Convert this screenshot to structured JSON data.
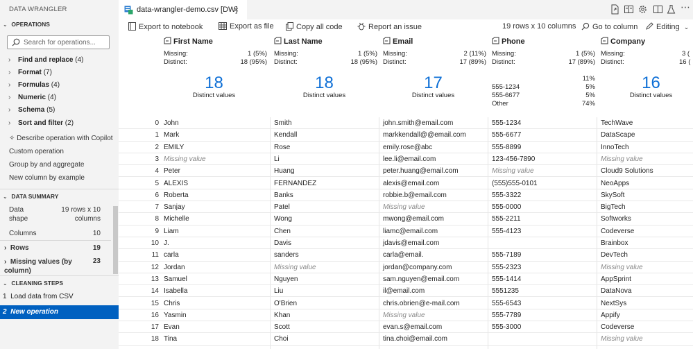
{
  "sidebar": {
    "title": "DATA WRANGLER",
    "operations_header": "OPERATIONS",
    "search_placeholder": "Search for operations...",
    "operation_groups": [
      {
        "label": "Find and replace",
        "count": "(4)"
      },
      {
        "label": "Format",
        "count": "(7)"
      },
      {
        "label": "Formulas",
        "count": "(4)"
      },
      {
        "label": "Numeric",
        "count": "(4)"
      },
      {
        "label": "Schema",
        "count": "(5)"
      },
      {
        "label": "Sort and filter",
        "count": "(2)"
      }
    ],
    "describe_copilot": "Describe operation with Copilot",
    "extra_ops": [
      "Custom operation",
      "Group by and aggregate",
      "New column by example"
    ],
    "data_summary_header": "DATA SUMMARY",
    "data_shape_label": "Data shape",
    "data_shape_value": "19 rows x 10 columns",
    "columns_label": "Columns",
    "columns_value": "10",
    "rows_label": "Rows",
    "rows_value": "19",
    "missing_label": "Missing values (by column)",
    "missing_value": "23",
    "cleaning_header": "CLEANING STEPS",
    "steps": [
      {
        "num": "1",
        "label": "Load data from CSV"
      },
      {
        "num": "2",
        "label": "New operation"
      }
    ]
  },
  "tab": {
    "title": "data-wrangler-demo.csv [DW]",
    "close": "×"
  },
  "toolbar": {
    "export_notebook": "Export to notebook",
    "export_file": "Export as file",
    "copy_code": "Copy all code",
    "report_issue": "Report an issue",
    "shape": "19 rows x 10 columns",
    "go_to_column": "Go to column",
    "editing": "Editing"
  },
  "columns": [
    {
      "name": "First Name",
      "missing": "1 (5%)",
      "distinct": "18 (95%)",
      "distinct_count": "18",
      "distinct_label": "Distinct values"
    },
    {
      "name": "Last Name",
      "missing": "1 (5%)",
      "distinct": "18 (95%)",
      "distinct_count": "18",
      "distinct_label": "Distinct values"
    },
    {
      "name": "Email",
      "missing": "2 (11%)",
      "distinct": "17 (89%)",
      "distinct_count": "17",
      "distinct_label": "Distinct values"
    },
    {
      "name": "Phone",
      "missing": "1 (5%)",
      "distinct": "17 (89%)",
      "top_values": [
        {
          "label": "",
          "pct": "11%"
        },
        {
          "label": "555-1234",
          "pct": "5%"
        },
        {
          "label": "555-6677",
          "pct": "5%"
        },
        {
          "label": "Other",
          "pct": "74%"
        }
      ]
    },
    {
      "name": "Company",
      "missing": "3 (",
      "distinct": "16 (",
      "distinct_count": "16",
      "distinct_label": "Distinct values"
    }
  ],
  "stat_labels": {
    "missing": "Missing:",
    "distinct": "Distinct:"
  },
  "missing_text": "Missing value",
  "rows": [
    {
      "i": "0",
      "c": [
        "John",
        "Smith",
        "john.smith@email.com",
        "555-1234",
        "TechWave"
      ]
    },
    {
      "i": "1",
      "c": [
        "Mark",
        "Kendall",
        "markkendall@@email.com",
        "555-6677",
        "DataScape"
      ]
    },
    {
      "i": "2",
      "c": [
        "EMILY",
        "Rose",
        "emily.rose@abc",
        "555-8899",
        "InnoTech"
      ]
    },
    {
      "i": "3",
      "c": [
        null,
        "Li",
        "lee.li@email.com",
        "123-456-7890",
        null
      ]
    },
    {
      "i": "4",
      "c": [
        "Peter",
        "Huang",
        "peter.huang@email.com",
        null,
        "Cloud9 Solutions"
      ]
    },
    {
      "i": "5",
      "c": [
        "ALEXIS",
        "FERNANDEZ",
        "alexis@email.com",
        "(555)555-0101",
        "NeoApps"
      ]
    },
    {
      "i": "6",
      "c": [
        "Roberta",
        "Banks",
        "robbie.b@email.com",
        "555-3322",
        "SkySoft"
      ]
    },
    {
      "i": "7",
      "c": [
        "Sanjay",
        "Patel",
        null,
        "555-0000",
        "BigTech"
      ]
    },
    {
      "i": "8",
      "c": [
        "Michelle",
        "Wong",
        "mwong@email.com",
        "555-2211",
        "Softworks"
      ]
    },
    {
      "i": "9",
      "c": [
        "Liam",
        "Chen",
        "liamc@email.com",
        "555-4123",
        "Codeverse"
      ]
    },
    {
      "i": "10",
      "c": [
        "J.",
        "Davis",
        "jdavis@email.com",
        "",
        "Brainbox"
      ]
    },
    {
      "i": "11",
      "c": [
        "carla",
        "sanders",
        "carla@email.",
        "555-7189",
        "DevTech"
      ]
    },
    {
      "i": "12",
      "c": [
        "Jordan",
        null,
        "jordan@company.com",
        "555-2323",
        null
      ]
    },
    {
      "i": "13",
      "c": [
        "Samuel",
        "Nguyen",
        "sam.nguyen@email.com",
        "555-1414",
        "AppSprint"
      ]
    },
    {
      "i": "14",
      "c": [
        "Isabella",
        "Liu",
        "il@email.com",
        "5551235",
        "DataNova"
      ]
    },
    {
      "i": "15",
      "c": [
        "Chris",
        "O'Brien",
        "chris.obrien@e-mail.com",
        "555-6543",
        "NextSys"
      ]
    },
    {
      "i": "16",
      "c": [
        "Yasmin",
        "Khan",
        null,
        "555-7789",
        "Appify"
      ]
    },
    {
      "i": "17",
      "c": [
        "Evan",
        "Scott",
        "evan.s@email.com",
        "555-3000",
        "Codeverse"
      ]
    },
    {
      "i": "18",
      "c": [
        "Tina",
        "Choi",
        "tina.choi@email.com",
        "",
        null
      ]
    }
  ],
  "colors": {
    "accent": "#0060c0",
    "distinct_blue": "#0e6fd6"
  }
}
